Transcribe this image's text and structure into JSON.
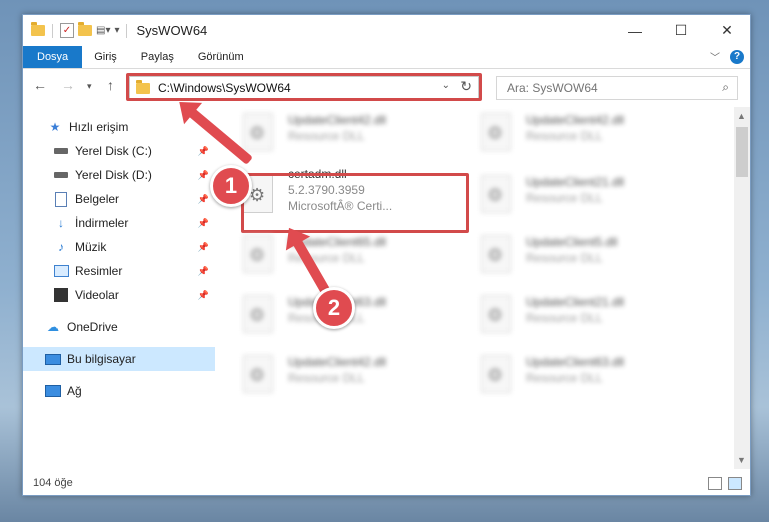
{
  "window": {
    "title": "SysWOW64"
  },
  "ribbon": {
    "tabs": [
      "Dosya",
      "Giriş",
      "Paylaş",
      "Görünüm"
    ]
  },
  "address": {
    "path": "C:\\Windows\\SysWOW64"
  },
  "search": {
    "placeholder": "Ara: SysWOW64"
  },
  "nav": {
    "items": [
      {
        "label": "Hızlı erişim",
        "icon": "star-icon"
      },
      {
        "label": "Yerel Disk (C:)",
        "icon": "drive-icon"
      },
      {
        "label": "Yerel Disk (D:)",
        "icon": "drive-icon"
      },
      {
        "label": "Belgeler",
        "icon": "documents-icon"
      },
      {
        "label": "İndirmeler",
        "icon": "download-icon"
      },
      {
        "label": "Müzik",
        "icon": "music-icon"
      },
      {
        "label": "Resimler",
        "icon": "pictures-icon"
      },
      {
        "label": "Videolar",
        "icon": "video-icon"
      },
      {
        "label": "OneDrive",
        "icon": "cloud-icon"
      },
      {
        "label": "Bu bilgisayar",
        "icon": "computer-icon"
      },
      {
        "label": "Ağ",
        "icon": "network-icon"
      }
    ]
  },
  "files": [
    {
      "name": "UpdateClient42.dll",
      "type": "Resource DLL"
    },
    {
      "name": "UpdateClient42.dll",
      "type": "Resource DLL"
    },
    {
      "name": "certadm.dll",
      "version": "5.2.3790.3959",
      "company": "MicrosoftÂ® Certi..."
    },
    {
      "name": "UpdateClient21.dll",
      "type": "Resource DLL"
    },
    {
      "name": "UpdateClient65.dll",
      "type": "Resource DLL"
    },
    {
      "name": "UpdateClient5.dll",
      "type": "Resource DLL"
    },
    {
      "name": "UpdateClient63.dll",
      "type": "Resource DLL"
    },
    {
      "name": "UpdateClient21.dll",
      "type": "Resource DLL"
    },
    {
      "name": "UpdateClient42.dll",
      "type": "Resource DLL"
    },
    {
      "name": "UpdateClient63.dll",
      "type": "Resource DLL"
    }
  ],
  "status": {
    "count": "104 öğe"
  },
  "annotations": {
    "step1": "1",
    "step2": "2"
  },
  "colors": {
    "accent": "#1979ca",
    "annotation": "#e04b50"
  }
}
